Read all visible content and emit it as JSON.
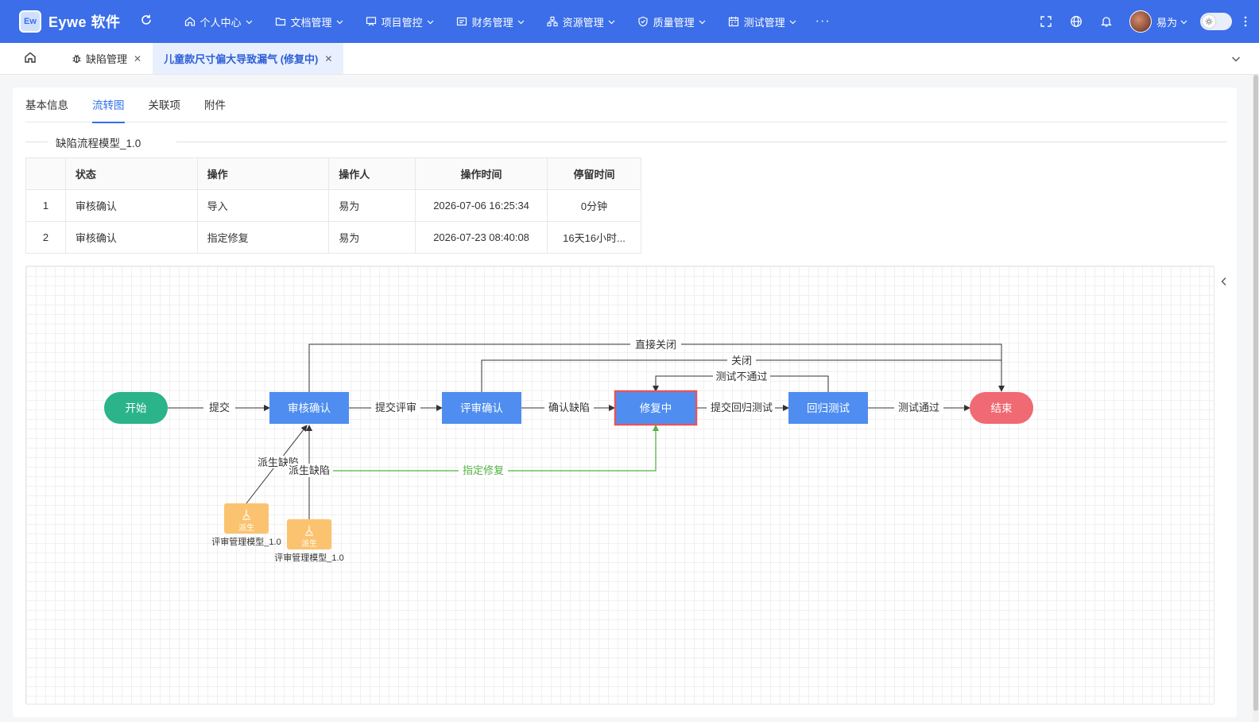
{
  "app": {
    "logo_mark": "Ew",
    "name": "Eywe 软件"
  },
  "nav": [
    {
      "label": "个人中心",
      "icon": "home-icon"
    },
    {
      "label": "文档管理",
      "icon": "folder-icon"
    },
    {
      "label": "项目管控",
      "icon": "project-icon"
    },
    {
      "label": "财务管理",
      "icon": "finance-icon"
    },
    {
      "label": "资源管理",
      "icon": "resource-icon"
    },
    {
      "label": "质量管理",
      "icon": "shield-icon"
    },
    {
      "label": "测试管理",
      "icon": "calendar-icon"
    }
  ],
  "nav_more": "···",
  "user": {
    "name": "易为"
  },
  "page_tabs": [
    {
      "label": "缺陷管理",
      "icon": "bug-icon",
      "active": false
    },
    {
      "label": "儿童款尺寸偏大导致漏气 (修复中)",
      "active": true
    }
  ],
  "subtabs": [
    "基本信息",
    "流转图",
    "关联项",
    "附件"
  ],
  "active_subtab": 1,
  "section_title": "缺陷流程模型_1.0",
  "table": {
    "headers": [
      "",
      "状态",
      "操作",
      "操作人",
      "操作时间",
      "停留时间"
    ],
    "rows": [
      [
        "1",
        "审核确认",
        "导入",
        "易为",
        "2026-07-06 16:25:34",
        "0分钟"
      ],
      [
        "2",
        "审核确认",
        "指定修复",
        "易为",
        "2026-07-23 08:40:08",
        "16天16小时..."
      ]
    ]
  },
  "flow": {
    "nodes": {
      "start": "开始",
      "review_confirm": "审核确认",
      "appraisal_confirm": "评审确认",
      "fixing": "修复中",
      "regression": "回归测试",
      "end": "结束",
      "derive_a": "派生",
      "derive_b": "派生",
      "derive_a_caption": "评审管理模型_1.0",
      "derive_b_caption": "评审管理模型_1.0"
    },
    "edges": {
      "submit": "提交",
      "submit_review": "提交评审",
      "confirm_defect": "确认缺陷",
      "submit_regression": "提交回归测试",
      "test_pass": "测试通过",
      "direct_close": "直接关闭",
      "close": "关闭",
      "test_fail": "测试不通过",
      "derive_defect_a": "派生缺陷",
      "derive_defect_b": "派生缺陷",
      "assign_fix": "指定修复"
    },
    "colors": {
      "start": "#2bb38a",
      "end": "#f06a73",
      "task": "#4f8ef0",
      "current_border": "#e05561",
      "derive": "#fbc36f",
      "assign_edge": "#52b043",
      "edge": "#333333"
    }
  },
  "theme": {
    "primary": "#3b6ee8",
    "active_tab_bg": "#e8f0ff"
  }
}
